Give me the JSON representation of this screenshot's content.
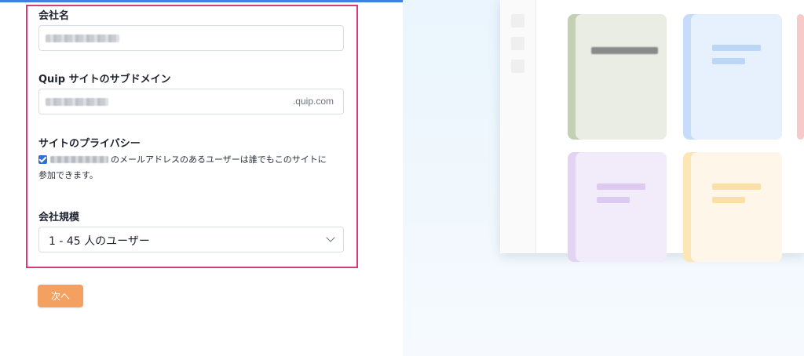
{
  "form": {
    "company_name_label": "会社名",
    "subdomain_label": "Quip サイトのサブドメイン",
    "subdomain_suffix": ".quip.com",
    "privacy_label": "サイトのプライバシー",
    "privacy_text_line1": "のメールアドレスのあるユーザーは誰でもこのサイトに",
    "privacy_text_line2": "参加できます。",
    "privacy_checked": true,
    "company_size_label": "会社規模",
    "company_size_value": "1 - 45 人のユーザー",
    "next_label": "次へ"
  },
  "colors": {
    "highlight_border": "#d63a77",
    "next_button": "#f4a061",
    "top_bar": "#3f7fe6",
    "doc_green": "#c3d0b4",
    "doc_blue": "#c6dcfa",
    "doc_purple": "#e3d4f3",
    "doc_yellow": "#fde6b6"
  }
}
